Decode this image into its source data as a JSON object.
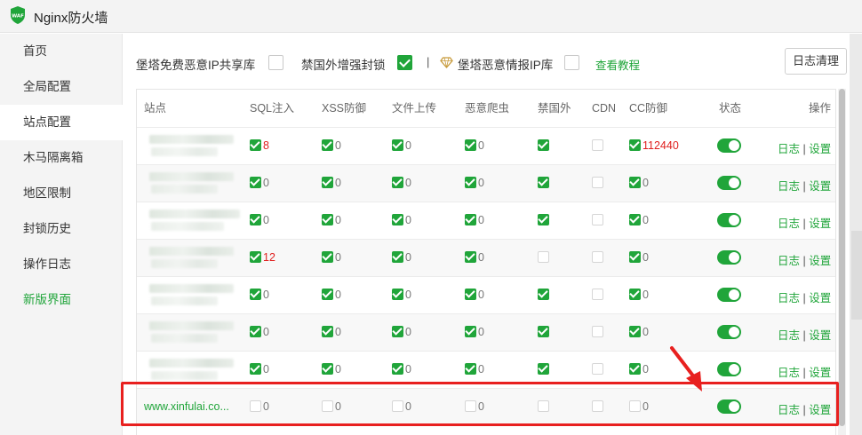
{
  "window": {
    "title": "Nginx防火墙",
    "logo_text": "WAF"
  },
  "sidebar": {
    "items": [
      {
        "label": "首页"
      },
      {
        "label": "全局配置"
      },
      {
        "label": "站点配置"
      },
      {
        "label": "木马隔离箱"
      },
      {
        "label": "地区限制"
      },
      {
        "label": "封锁历史"
      },
      {
        "label": "操作日志"
      },
      {
        "label": "新版界面"
      }
    ],
    "active_index": 2
  },
  "toolbar": {
    "shared_ip_label": "堡塔免费恶意IP共享库",
    "shared_ip_checked": false,
    "block_foreign_label": "禁国外增强封锁",
    "block_foreign_checked": true,
    "separator": "|",
    "intel_ip_label": "堡塔恶意情报IP库",
    "intel_ip_checked": false,
    "tutorial_link": "查看教程",
    "clear_logs_button": "日志清理"
  },
  "table": {
    "headers": [
      "站点",
      "SQL注入",
      "XSS防御",
      "文件上传",
      "恶意爬虫",
      "禁国外",
      "CDN",
      "CC防御",
      "状态",
      "操作"
    ],
    "op_log": "日志",
    "op_sep": "|",
    "op_settings": "设置",
    "rows": [
      {
        "site": "",
        "sql": {
          "on": true,
          "count": "8",
          "red": true
        },
        "xss": {
          "on": true,
          "count": "0"
        },
        "upload": {
          "on": true,
          "count": "0"
        },
        "crawler": {
          "on": true,
          "count": "0"
        },
        "foreign": true,
        "cdn": false,
        "cc": {
          "on": true,
          "count": "112440",
          "red": true
        },
        "status": true
      },
      {
        "site": "",
        "sql": {
          "on": true,
          "count": "0"
        },
        "xss": {
          "on": true,
          "count": "0"
        },
        "upload": {
          "on": true,
          "count": "0"
        },
        "crawler": {
          "on": true,
          "count": "0"
        },
        "foreign": true,
        "cdn": false,
        "cc": {
          "on": true,
          "count": "0"
        },
        "status": true
      },
      {
        "site": "",
        "sql": {
          "on": true,
          "count": "0"
        },
        "xss": {
          "on": true,
          "count": "0"
        },
        "upload": {
          "on": true,
          "count": "0"
        },
        "crawler": {
          "on": true,
          "count": "0"
        },
        "foreign": true,
        "cdn": false,
        "cc": {
          "on": true,
          "count": "0"
        },
        "status": true
      },
      {
        "site": "",
        "sql": {
          "on": true,
          "count": "12",
          "red": true
        },
        "xss": {
          "on": true,
          "count": "0"
        },
        "upload": {
          "on": true,
          "count": "0"
        },
        "crawler": {
          "on": true,
          "count": "0"
        },
        "foreign": false,
        "cdn": false,
        "cc": {
          "on": true,
          "count": "0"
        },
        "status": true
      },
      {
        "site": "",
        "sql": {
          "on": true,
          "count": "0"
        },
        "xss": {
          "on": true,
          "count": "0"
        },
        "upload": {
          "on": true,
          "count": "0"
        },
        "crawler": {
          "on": true,
          "count": "0"
        },
        "foreign": true,
        "cdn": false,
        "cc": {
          "on": true,
          "count": "0"
        },
        "status": true
      },
      {
        "site": "",
        "sql": {
          "on": true,
          "count": "0"
        },
        "xss": {
          "on": true,
          "count": "0"
        },
        "upload": {
          "on": true,
          "count": "0"
        },
        "crawler": {
          "on": true,
          "count": "0"
        },
        "foreign": true,
        "cdn": false,
        "cc": {
          "on": true,
          "count": "0"
        },
        "status": true
      },
      {
        "site": "",
        "sql": {
          "on": true,
          "count": "0"
        },
        "xss": {
          "on": true,
          "count": "0"
        },
        "upload": {
          "on": true,
          "count": "0"
        },
        "crawler": {
          "on": true,
          "count": "0"
        },
        "foreign": true,
        "cdn": false,
        "cc": {
          "on": true,
          "count": "0"
        },
        "status": true
      },
      {
        "site": "www.xinfulai.co...",
        "sql": {
          "on": false,
          "count": "0"
        },
        "xss": {
          "on": false,
          "count": "0"
        },
        "upload": {
          "on": false,
          "count": "0"
        },
        "crawler": {
          "on": false,
          "count": "0"
        },
        "foreign": false,
        "cdn": false,
        "cc": {
          "on": false,
          "count": "0"
        },
        "status": true
      }
    ]
  },
  "colors": {
    "accent": "#20a53a",
    "alert": "#e0201f",
    "highlight_border": "#e8201f"
  }
}
